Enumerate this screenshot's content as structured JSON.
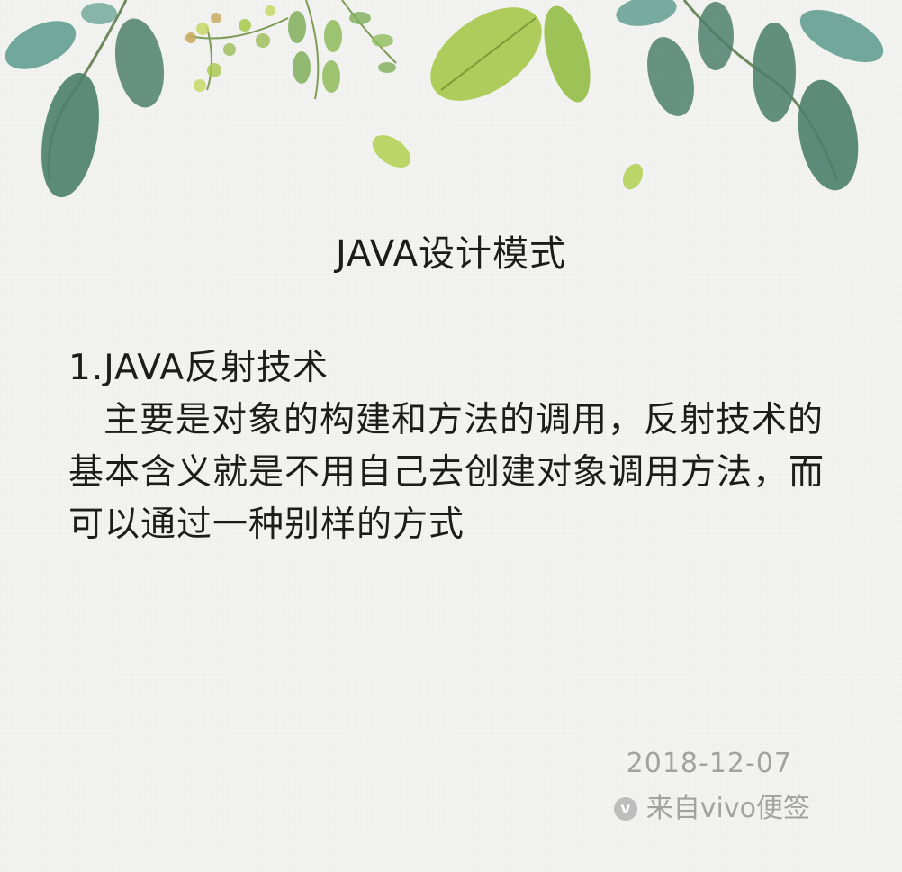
{
  "note": {
    "title": "JAVA设计模式",
    "heading": "1.JAVA反射技术",
    "body": "主要是对象的构建和方法的调用，反射技术的基本含义就是不用自己去创建对象调用方法，而可以通过一种别样的方式",
    "date": "2018-12-07",
    "source_badge": "v",
    "source": "来自vivo便签"
  },
  "decor": {
    "theme": "watercolor-leaves-border",
    "colors": {
      "dark_leaf": "#4d7f6c",
      "teal_leaf": "#5a9a8c",
      "lime_leaf": "#a6c84a",
      "yellow_green": "#c6d868",
      "branch": "#6f8a5e",
      "paper": "#f3f3f1",
      "meta_text": "#a2a2a2"
    }
  }
}
